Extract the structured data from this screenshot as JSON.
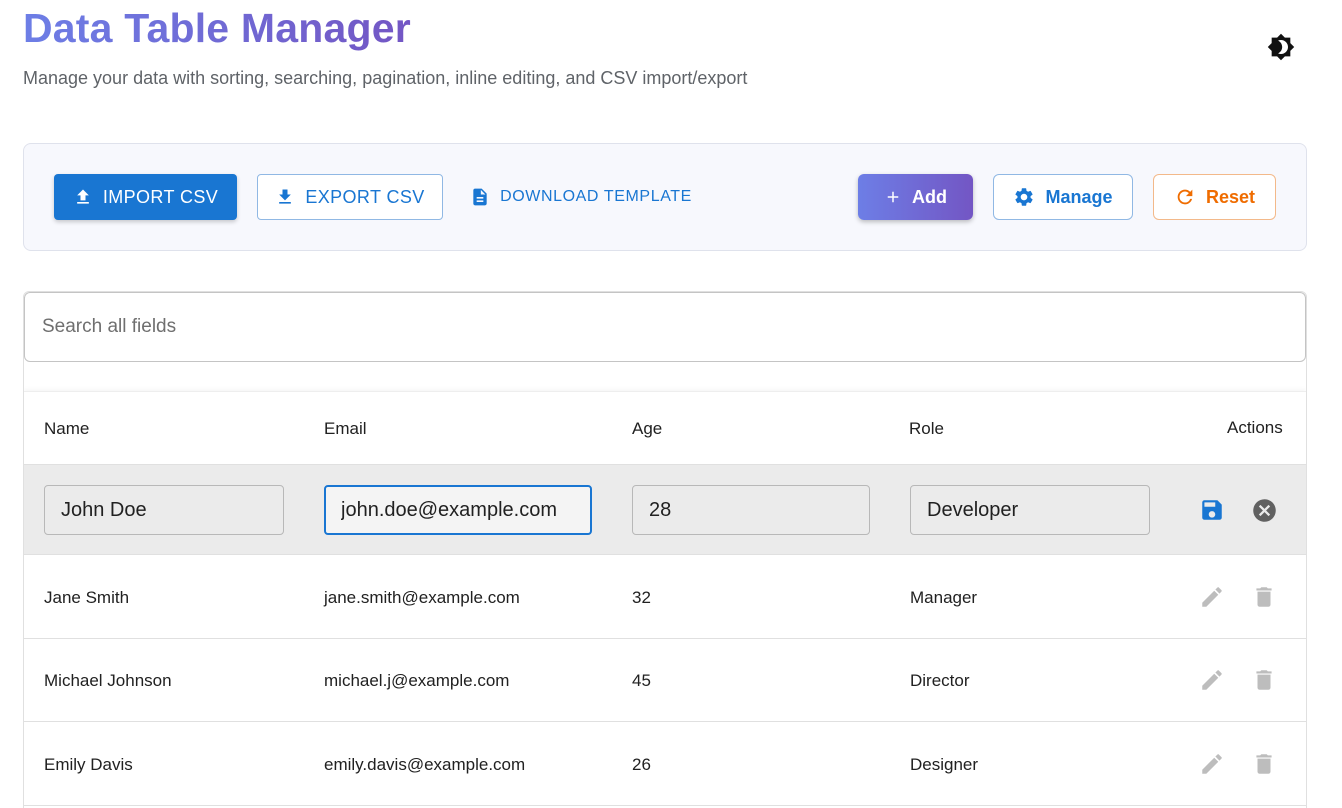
{
  "header": {
    "title": "Data Table Manager",
    "subtitle": "Manage your data with sorting, searching, pagination, inline editing, and CSV import/export"
  },
  "toolbar": {
    "import_label": "IMPORT CSV",
    "export_label": "EXPORT CSV",
    "template_label": "DOWNLOAD TEMPLATE",
    "add_label": "Add",
    "manage_label": "Manage",
    "reset_label": "Reset"
  },
  "search": {
    "placeholder": "Search all fields",
    "value": ""
  },
  "table": {
    "columns": [
      "Name",
      "Email",
      "Age",
      "Role",
      "Actions"
    ],
    "editing_row": {
      "name": "John Doe",
      "email": "john.doe@example.com",
      "age": "28",
      "role": "Developer"
    },
    "rows": [
      {
        "name": "Jane Smith",
        "email": "jane.smith@example.com",
        "age": "32",
        "role": "Manager"
      },
      {
        "name": "Michael Johnson",
        "email": "michael.j@example.com",
        "age": "45",
        "role": "Director"
      },
      {
        "name": "Emily Davis",
        "email": "emily.davis@example.com",
        "age": "26",
        "role": "Designer"
      }
    ]
  },
  "colors": {
    "primary": "#1976d2",
    "gradient_start": "#6d7ee6",
    "gradient_end": "#7356c4",
    "reset": "#ef6c00",
    "disabled_icon": "#bdbdbd"
  },
  "icons": {
    "theme": "brightness-icon",
    "import": "upload-icon",
    "export": "download-icon",
    "template": "file-icon",
    "add": "plus-icon",
    "manage": "gear-icon",
    "reset": "refresh-icon",
    "save": "save-icon",
    "cancel": "cancel-icon",
    "edit": "pencil-icon",
    "delete": "trash-icon"
  }
}
